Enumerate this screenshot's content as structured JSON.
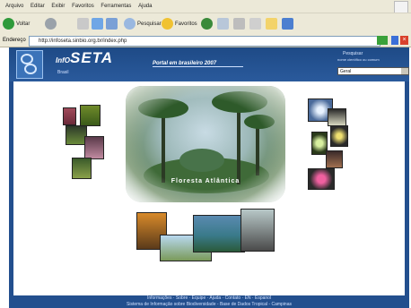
{
  "browser": {
    "menu": [
      "Arquivo",
      "Editar",
      "Exibir",
      "Favoritos",
      "Ferramentas",
      "Ajuda"
    ],
    "back_label": "Voltar",
    "search_label": "Pesquisar",
    "favorites_label": "Favoritos",
    "address_label": "Endereço",
    "address": "http://infoseta.sinbio.org.br/index.php"
  },
  "site": {
    "brand_prefix": "InfO",
    "brand_main": "SETA",
    "region": "Brasil",
    "portal_title": "Portal em brasileiro 2007",
    "search_label": "Pesquisar",
    "search_sub": "nome científico ou comum",
    "search_select_value": "Geral"
  },
  "hero": {
    "caption": "Floresta Atlântica"
  },
  "footer": {
    "links": "Informações · Sobre · Equipe · Ajuda · Contato · EN · Espanol",
    "sub": "Sistema de Informação sobre Biodiversidade - Base de Dados Tropical - Campinas"
  },
  "colors": {
    "header_blue": "#1e4a86",
    "border_blue": "#234f8e",
    "chrome": "#ece9d8"
  }
}
